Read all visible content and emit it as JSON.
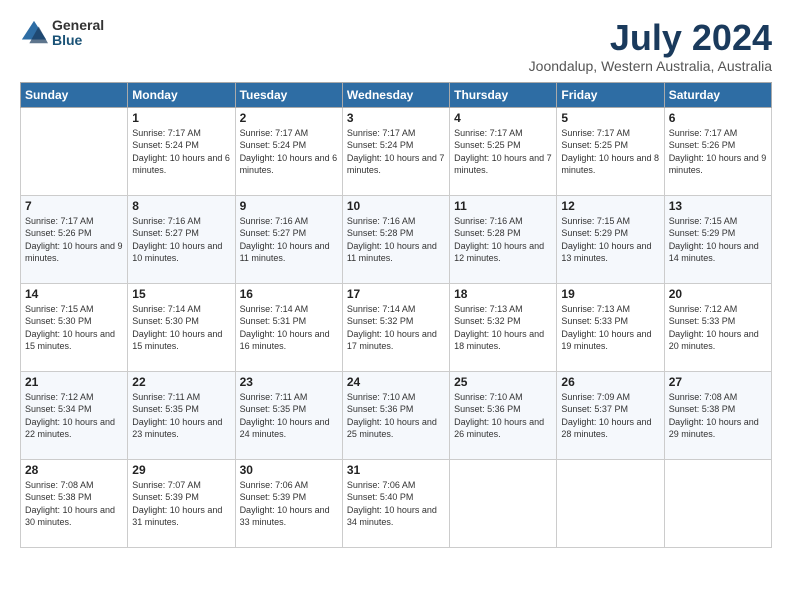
{
  "logo": {
    "general": "General",
    "blue": "Blue"
  },
  "title": "July 2024",
  "location": "Joondalup, Western Australia, Australia",
  "headers": [
    "Sunday",
    "Monday",
    "Tuesday",
    "Wednesday",
    "Thursday",
    "Friday",
    "Saturday"
  ],
  "weeks": [
    [
      {
        "day": "",
        "sunrise": "",
        "sunset": "",
        "daylight": ""
      },
      {
        "day": "1",
        "sunrise": "Sunrise: 7:17 AM",
        "sunset": "Sunset: 5:24 PM",
        "daylight": "Daylight: 10 hours and 6 minutes."
      },
      {
        "day": "2",
        "sunrise": "Sunrise: 7:17 AM",
        "sunset": "Sunset: 5:24 PM",
        "daylight": "Daylight: 10 hours and 6 minutes."
      },
      {
        "day": "3",
        "sunrise": "Sunrise: 7:17 AM",
        "sunset": "Sunset: 5:24 PM",
        "daylight": "Daylight: 10 hours and 7 minutes."
      },
      {
        "day": "4",
        "sunrise": "Sunrise: 7:17 AM",
        "sunset": "Sunset: 5:25 PM",
        "daylight": "Daylight: 10 hours and 7 minutes."
      },
      {
        "day": "5",
        "sunrise": "Sunrise: 7:17 AM",
        "sunset": "Sunset: 5:25 PM",
        "daylight": "Daylight: 10 hours and 8 minutes."
      },
      {
        "day": "6",
        "sunrise": "Sunrise: 7:17 AM",
        "sunset": "Sunset: 5:26 PM",
        "daylight": "Daylight: 10 hours and 9 minutes."
      }
    ],
    [
      {
        "day": "7",
        "sunrise": "Sunrise: 7:17 AM",
        "sunset": "Sunset: 5:26 PM",
        "daylight": "Daylight: 10 hours and 9 minutes."
      },
      {
        "day": "8",
        "sunrise": "Sunrise: 7:16 AM",
        "sunset": "Sunset: 5:27 PM",
        "daylight": "Daylight: 10 hours and 10 minutes."
      },
      {
        "day": "9",
        "sunrise": "Sunrise: 7:16 AM",
        "sunset": "Sunset: 5:27 PM",
        "daylight": "Daylight: 10 hours and 11 minutes."
      },
      {
        "day": "10",
        "sunrise": "Sunrise: 7:16 AM",
        "sunset": "Sunset: 5:28 PM",
        "daylight": "Daylight: 10 hours and 11 minutes."
      },
      {
        "day": "11",
        "sunrise": "Sunrise: 7:16 AM",
        "sunset": "Sunset: 5:28 PM",
        "daylight": "Daylight: 10 hours and 12 minutes."
      },
      {
        "day": "12",
        "sunrise": "Sunrise: 7:15 AM",
        "sunset": "Sunset: 5:29 PM",
        "daylight": "Daylight: 10 hours and 13 minutes."
      },
      {
        "day": "13",
        "sunrise": "Sunrise: 7:15 AM",
        "sunset": "Sunset: 5:29 PM",
        "daylight": "Daylight: 10 hours and 14 minutes."
      }
    ],
    [
      {
        "day": "14",
        "sunrise": "Sunrise: 7:15 AM",
        "sunset": "Sunset: 5:30 PM",
        "daylight": "Daylight: 10 hours and 15 minutes."
      },
      {
        "day": "15",
        "sunrise": "Sunrise: 7:14 AM",
        "sunset": "Sunset: 5:30 PM",
        "daylight": "Daylight: 10 hours and 15 minutes."
      },
      {
        "day": "16",
        "sunrise": "Sunrise: 7:14 AM",
        "sunset": "Sunset: 5:31 PM",
        "daylight": "Daylight: 10 hours and 16 minutes."
      },
      {
        "day": "17",
        "sunrise": "Sunrise: 7:14 AM",
        "sunset": "Sunset: 5:32 PM",
        "daylight": "Daylight: 10 hours and 17 minutes."
      },
      {
        "day": "18",
        "sunrise": "Sunrise: 7:13 AM",
        "sunset": "Sunset: 5:32 PM",
        "daylight": "Daylight: 10 hours and 18 minutes."
      },
      {
        "day": "19",
        "sunrise": "Sunrise: 7:13 AM",
        "sunset": "Sunset: 5:33 PM",
        "daylight": "Daylight: 10 hours and 19 minutes."
      },
      {
        "day": "20",
        "sunrise": "Sunrise: 7:12 AM",
        "sunset": "Sunset: 5:33 PM",
        "daylight": "Daylight: 10 hours and 20 minutes."
      }
    ],
    [
      {
        "day": "21",
        "sunrise": "Sunrise: 7:12 AM",
        "sunset": "Sunset: 5:34 PM",
        "daylight": "Daylight: 10 hours and 22 minutes."
      },
      {
        "day": "22",
        "sunrise": "Sunrise: 7:11 AM",
        "sunset": "Sunset: 5:35 PM",
        "daylight": "Daylight: 10 hours and 23 minutes."
      },
      {
        "day": "23",
        "sunrise": "Sunrise: 7:11 AM",
        "sunset": "Sunset: 5:35 PM",
        "daylight": "Daylight: 10 hours and 24 minutes."
      },
      {
        "day": "24",
        "sunrise": "Sunrise: 7:10 AM",
        "sunset": "Sunset: 5:36 PM",
        "daylight": "Daylight: 10 hours and 25 minutes."
      },
      {
        "day": "25",
        "sunrise": "Sunrise: 7:10 AM",
        "sunset": "Sunset: 5:36 PM",
        "daylight": "Daylight: 10 hours and 26 minutes."
      },
      {
        "day": "26",
        "sunrise": "Sunrise: 7:09 AM",
        "sunset": "Sunset: 5:37 PM",
        "daylight": "Daylight: 10 hours and 28 minutes."
      },
      {
        "day": "27",
        "sunrise": "Sunrise: 7:08 AM",
        "sunset": "Sunset: 5:38 PM",
        "daylight": "Daylight: 10 hours and 29 minutes."
      }
    ],
    [
      {
        "day": "28",
        "sunrise": "Sunrise: 7:08 AM",
        "sunset": "Sunset: 5:38 PM",
        "daylight": "Daylight: 10 hours and 30 minutes."
      },
      {
        "day": "29",
        "sunrise": "Sunrise: 7:07 AM",
        "sunset": "Sunset: 5:39 PM",
        "daylight": "Daylight: 10 hours and 31 minutes."
      },
      {
        "day": "30",
        "sunrise": "Sunrise: 7:06 AM",
        "sunset": "Sunset: 5:39 PM",
        "daylight": "Daylight: 10 hours and 33 minutes."
      },
      {
        "day": "31",
        "sunrise": "Sunrise: 7:06 AM",
        "sunset": "Sunset: 5:40 PM",
        "daylight": "Daylight: 10 hours and 34 minutes."
      },
      {
        "day": "",
        "sunrise": "",
        "sunset": "",
        "daylight": ""
      },
      {
        "day": "",
        "sunrise": "",
        "sunset": "",
        "daylight": ""
      },
      {
        "day": "",
        "sunrise": "",
        "sunset": "",
        "daylight": ""
      }
    ]
  ]
}
